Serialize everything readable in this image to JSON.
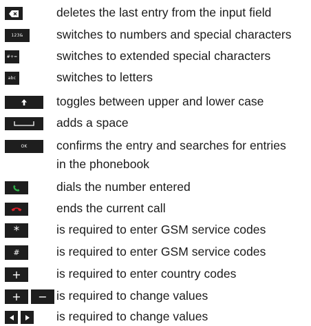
{
  "legend": [
    {
      "id": "backspace",
      "icon": "backspace-icon",
      "key_label": "",
      "description": "deletes the last entry from the input field"
    },
    {
      "id": "numbers",
      "icon": "numbers-key",
      "key_label": "123&",
      "description": "switches to numbers and special characters"
    },
    {
      "id": "extended",
      "icon": "extended-key",
      "key_label": "#+=",
      "description": "switches to extended special characters"
    },
    {
      "id": "letters",
      "icon": "letters-key",
      "key_label": "abc",
      "description": "switches to letters"
    },
    {
      "id": "shift",
      "icon": "shift-arrow-icon",
      "key_label": "",
      "description": "toggles between upper and lower case"
    },
    {
      "id": "space",
      "icon": "space-bar-icon",
      "key_label": "",
      "description": "adds a space"
    },
    {
      "id": "ok",
      "icon": "ok-key",
      "key_label": "OK",
      "description": "confirms the entry and searches for entries",
      "description_line2": "in the phonebook"
    },
    {
      "id": "dial",
      "icon": "phone-dial-icon",
      "key_label": "",
      "description": "dials the number entered",
      "color": "#2fb34a"
    },
    {
      "id": "end",
      "icon": "phone-end-icon",
      "key_label": "",
      "description": "ends the current call",
      "color": "#e0202a"
    },
    {
      "id": "star",
      "icon": "star-key",
      "key_label": "*",
      "description": "is required to enter GSM service codes"
    },
    {
      "id": "hash",
      "icon": "hash-key",
      "key_label": "#",
      "description": "is required to enter GSM service codes"
    },
    {
      "id": "plus",
      "icon": "plus-key",
      "key_label": "+",
      "description": "is required to enter country codes"
    },
    {
      "id": "plusminus",
      "icon": "plus-minus-keys",
      "key_label": "+",
      "key_label_2": "−",
      "description": "is required to change values"
    },
    {
      "id": "arrows",
      "icon": "left-right-arrow-keys",
      "key_label": "",
      "description": "is required to change values"
    }
  ],
  "colors": {
    "key_bg": "#1e1e1e",
    "key_fg": "#ffffff",
    "dial": "#2fb34a",
    "end": "#e0202a"
  }
}
